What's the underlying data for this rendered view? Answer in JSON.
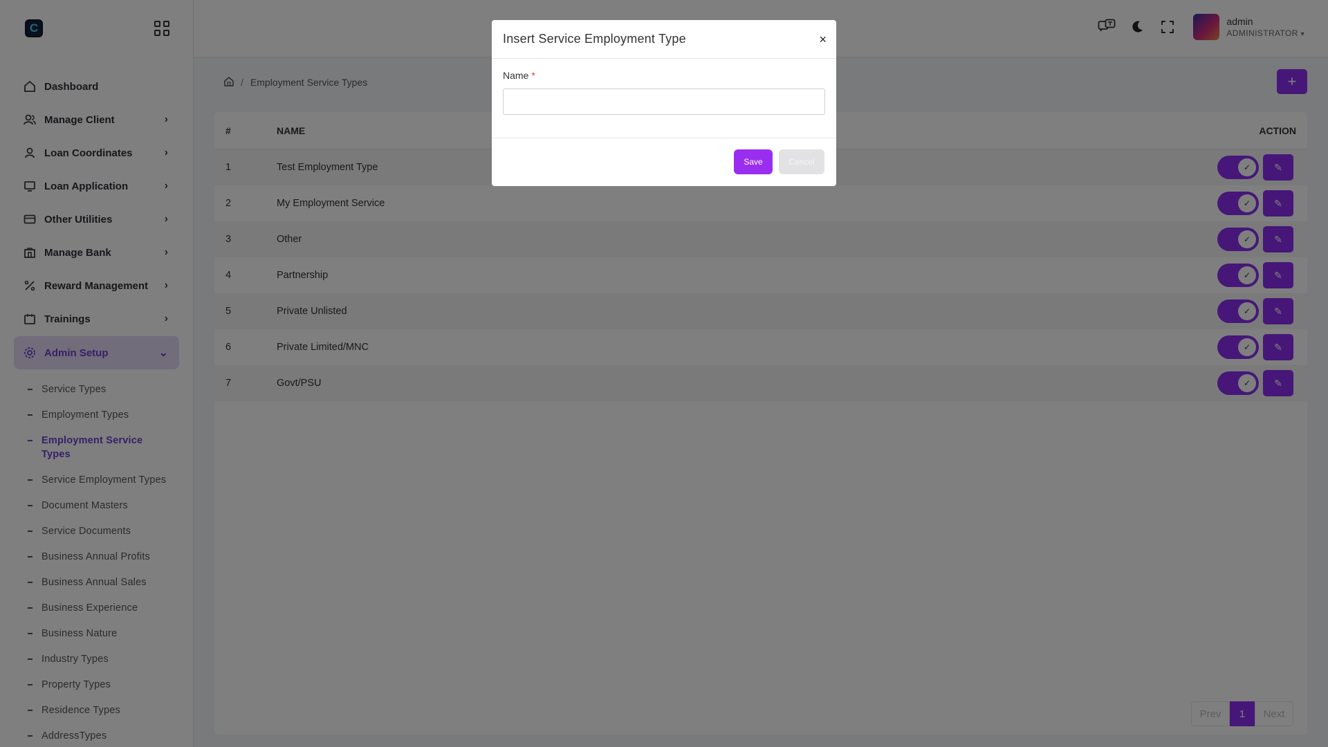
{
  "brand": {
    "logo_letter": "C"
  },
  "sidebar": {
    "items": [
      {
        "label": "Dashboard",
        "icon": "home-icon"
      },
      {
        "label": "Manage Client",
        "icon": "users-icon"
      },
      {
        "label": "Loan Coordinates",
        "icon": "user-icon"
      },
      {
        "label": "Loan Application",
        "icon": "monitor-icon"
      },
      {
        "label": "Other Utilities",
        "icon": "card-icon"
      },
      {
        "label": "Manage Bank",
        "icon": "bank-icon"
      },
      {
        "label": "Reward Management",
        "icon": "percent-icon"
      },
      {
        "label": "Trainings",
        "icon": "calendar-icon"
      },
      {
        "label": "Admin Setup",
        "icon": "gear-icon"
      }
    ],
    "subitems": [
      "Service Types",
      "Employment Types",
      "Employment Service Types",
      "Service Employment Types",
      "Document Masters",
      "Service Documents",
      "Business Annual Profits",
      "Business Annual Sales",
      "Business Experience",
      "Business Nature",
      "Industry Types",
      "Property Types",
      "Residence Types",
      "AddressTypes"
    ]
  },
  "header": {
    "user_name": "admin",
    "user_role": "ADMINISTRATOR"
  },
  "breadcrumb": {
    "current": "Employment Service Types"
  },
  "table": {
    "headers": {
      "num": "#",
      "name": "NAME",
      "action": "ACTION"
    },
    "rows": [
      {
        "num": "1",
        "name": "Test Employment Type"
      },
      {
        "num": "2",
        "name": "My Employment Service"
      },
      {
        "num": "3",
        "name": "Other"
      },
      {
        "num": "4",
        "name": "Partnership"
      },
      {
        "num": "5",
        "name": "Private Unlisted"
      },
      {
        "num": "6",
        "name": "Private Limited/MNC"
      },
      {
        "num": "7",
        "name": "Govt/PSU"
      }
    ]
  },
  "pager": {
    "prev": "Prev",
    "page": "1",
    "next": "Next"
  },
  "modal": {
    "title": "Insert Service Employment Type",
    "close": "×",
    "name_label": "Name",
    "required": "*",
    "name_value": "",
    "save": "Save",
    "cancel": "Cancel"
  },
  "colors": {
    "accent": "#8c2ef0",
    "active_bg": "#e2dbf7",
    "active_text": "#6c3fd1"
  }
}
